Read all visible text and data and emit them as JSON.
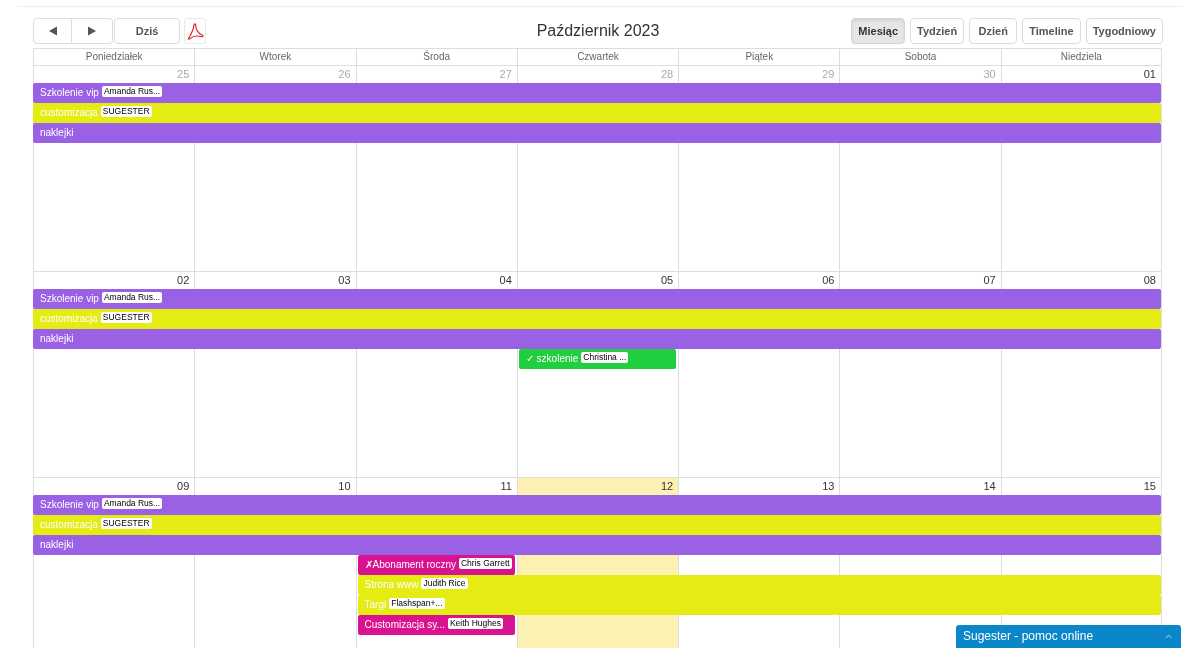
{
  "toolbar": {
    "today_button": "Dziś",
    "title": "Październik 2023",
    "views": [
      {
        "label": "Miesiąc",
        "selected": true
      },
      {
        "label": "Tydzień",
        "selected": false
      },
      {
        "label": "Dzień",
        "selected": false
      },
      {
        "label": "Timeline",
        "selected": false
      },
      {
        "label": "Tygodniowy",
        "selected": false
      }
    ]
  },
  "weekdays": [
    "Poniedziałek",
    "Wtorek",
    "Środa",
    "Czwartek",
    "Piątek",
    "Sobota",
    "Niedziela"
  ],
  "weeks": [
    {
      "days": [
        {
          "number": "25",
          "other_month": true,
          "today": false,
          "events": [
            {
              "title": "Szkolenie vip",
              "tag": "Amanda Rus...",
              "color": "#9b61e4",
              "kind": "rest_of_week"
            },
            {
              "title": "customizacja",
              "tag": "SUGESTER",
              "color": "#e4ec14",
              "kind": "rest_of_week"
            },
            {
              "title": "naklejki",
              "color": "#9b61e4",
              "kind": "rest_of_week"
            }
          ]
        },
        {
          "number": "26",
          "other_month": true,
          "today": false
        },
        {
          "number": "27",
          "other_month": true,
          "today": false
        },
        {
          "number": "28",
          "other_month": true,
          "today": false
        },
        {
          "number": "29",
          "other_month": true,
          "today": false
        },
        {
          "number": "30",
          "other_month": true,
          "today": false
        },
        {
          "number": "01",
          "other_month": false,
          "today": false
        }
      ]
    },
    {
      "days": [
        {
          "number": "02",
          "other_month": false,
          "today": false,
          "events": [
            {
              "title": "Szkolenie vip",
              "tag": "Amanda Rus...",
              "color": "#9b61e4",
              "kind": "rest_of_week"
            },
            {
              "title": "customizacja",
              "tag": "SUGESTER",
              "color": "#e4ec14",
              "kind": "rest_of_week"
            },
            {
              "title": "naklejki",
              "color": "#9b61e4",
              "kind": "rest_of_week"
            }
          ]
        },
        {
          "number": "03",
          "other_month": false,
          "today": false
        },
        {
          "number": "04",
          "other_month": false,
          "today": false
        },
        {
          "number": "05",
          "other_month": false,
          "today": false,
          "events": [
            {
              "title": "✓ szkolenie",
              "tag": "Christina ...",
              "color": "#20cf40",
              "kind": "one_day"
            }
          ]
        },
        {
          "number": "06",
          "other_month": false,
          "today": false
        },
        {
          "number": "07",
          "other_month": false,
          "today": false
        },
        {
          "number": "08",
          "other_month": false,
          "today": false
        }
      ]
    },
    {
      "days": [
        {
          "number": "09",
          "other_month": false,
          "today": false,
          "events": [
            {
              "title": "Szkolenie vip",
              "tag": "Amanda Rus...",
              "color": "#9b61e4",
              "kind": "rest_of_week"
            },
            {
              "title": "customizacja",
              "tag": "SUGESTER",
              "color": "#e4ec14",
              "kind": "rest_of_week"
            },
            {
              "title": "naklejki",
              "color": "#9b61e4",
              "kind": "rest_of_week"
            }
          ]
        },
        {
          "number": "10",
          "other_month": false,
          "today": false
        },
        {
          "number": "11",
          "other_month": false,
          "today": false,
          "events": [
            {
              "title": "✗Abonament roczny",
              "tag": "Chris Garrett",
              "color": "#d9138f",
              "kind": "one_day"
            },
            {
              "title": "Strona www",
              "tag": "Judith Rice",
              "color": "#e4ec14",
              "kind": "rest_of_week"
            },
            {
              "title": "Targi",
              "tag": "Flashspan+...",
              "color": "#e4ec14",
              "kind": "rest_of_week"
            },
            {
              "title": "Customizacja sy...",
              "tag": "Keith Hughes",
              "color": "#d9138f",
              "kind": "one_day"
            }
          ]
        },
        {
          "number": "12",
          "other_month": false,
          "today": true
        },
        {
          "number": "13",
          "other_month": false,
          "today": false
        },
        {
          "number": "14",
          "other_month": false,
          "today": false
        },
        {
          "number": "15",
          "other_month": false,
          "today": false
        }
      ]
    }
  ],
  "help_widget": {
    "label": "Sugester - pomoc online"
  }
}
